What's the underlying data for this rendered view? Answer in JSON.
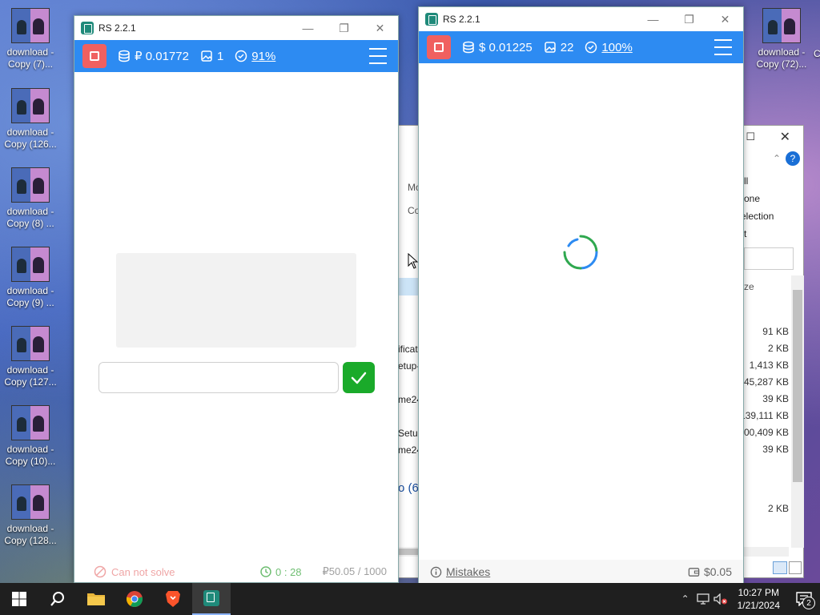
{
  "desktop": {
    "icons": [
      {
        "label1": "download -",
        "label2": "Copy (7)..."
      },
      {
        "label1": "download -",
        "label2": "Copy (126..."
      },
      {
        "label1": "download -",
        "label2": "Copy (8) ..."
      },
      {
        "label1": "download -",
        "label2": "Copy (9) ..."
      },
      {
        "label1": "download -",
        "label2": "Copy (127..."
      },
      {
        "label1": "download -",
        "label2": "Copy (10)..."
      },
      {
        "label1": "download -",
        "label2": "Copy (128..."
      }
    ],
    "right_icon": {
      "label1": "download -",
      "label2": "Copy (72)..."
    },
    "partial_right_text": "C"
  },
  "explorer": {
    "ribbon_items": [
      "ll",
      "one",
      "election",
      "t"
    ],
    "left_items": [
      "Mo",
      "Co"
    ],
    "file_fragments": [
      "ificat",
      "etup-",
      "me24",
      "Setup",
      "me24",
      "o (6"
    ],
    "size_header": "ze",
    "sizes": [
      "91 KB",
      "2 KB",
      "1,413 KB",
      "45,287 KB",
      "39 KB",
      "139,111 KB",
      "100,409 KB",
      "39 KB",
      "2 KB"
    ]
  },
  "window1": {
    "title": "RS 2.2.1",
    "balance": "₽ 0.01772",
    "images_count": "1",
    "accuracy": "91%",
    "answer_placeholder": "",
    "footer_cant_solve": "Can not solve",
    "footer_timer": "0 : 28",
    "footer_balance": "₽50.05 / 1000"
  },
  "window2": {
    "title": "RS 2.2.1",
    "balance": "$ 0.01225",
    "images_count": "22",
    "accuracy": "100%",
    "mistakes_label": "Mistakes",
    "wallet_value": "$0.05"
  },
  "taskbar": {
    "time": "10:27 PM",
    "date": "1/21/2024",
    "notification_count": "2"
  },
  "colors": {
    "accent_blue": "#2d8bf2",
    "stop_red": "#f06060",
    "confirm_green": "#1aaa2a"
  }
}
